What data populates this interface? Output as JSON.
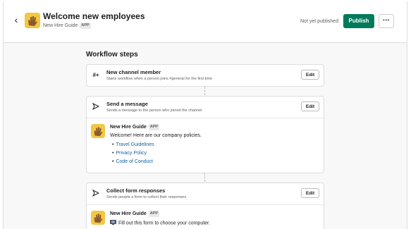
{
  "header": {
    "back_icon": "chevron-left-icon",
    "avatar_icon": "waving-hand-icon",
    "title": "Welcome new employees",
    "app_name": "New Hire Guide",
    "app_badge": "APP",
    "status": "Not yet published",
    "publish_label": "Publish",
    "more_icon": "ellipsis-icon",
    "publish_color": "#007a5a"
  },
  "main": {
    "heading": "Workflow steps",
    "steps": [
      {
        "icon": "hash-plus-icon",
        "title": "New channel member",
        "description": "Starts workflow when a person joins #general for the first time",
        "edit_label": "Edit"
      },
      {
        "icon": "send-icon",
        "title": "Send a message",
        "description": "Sends a message to the person who joined the channel",
        "edit_label": "Edit",
        "message": {
          "author": "New Hire Guide",
          "badge": "APP",
          "text": "Welcome! Here are our company policies.",
          "links": [
            "Travel Guidelines",
            "Privacy Policy",
            "Code of Conduct"
          ]
        }
      },
      {
        "icon": "send-icon",
        "title": "Collect form responses",
        "description": "Sends people a form to collect their responses",
        "edit_label": "Edit",
        "message": {
          "author": "New Hire Guide",
          "badge": "APP",
          "emoji_icon": "computer-icon",
          "text": "Fill out this form to choose your computer."
        }
      }
    ]
  },
  "colors": {
    "link": "#1264a3",
    "background": "#f8f8f8",
    "avatar": "#f2c744"
  }
}
